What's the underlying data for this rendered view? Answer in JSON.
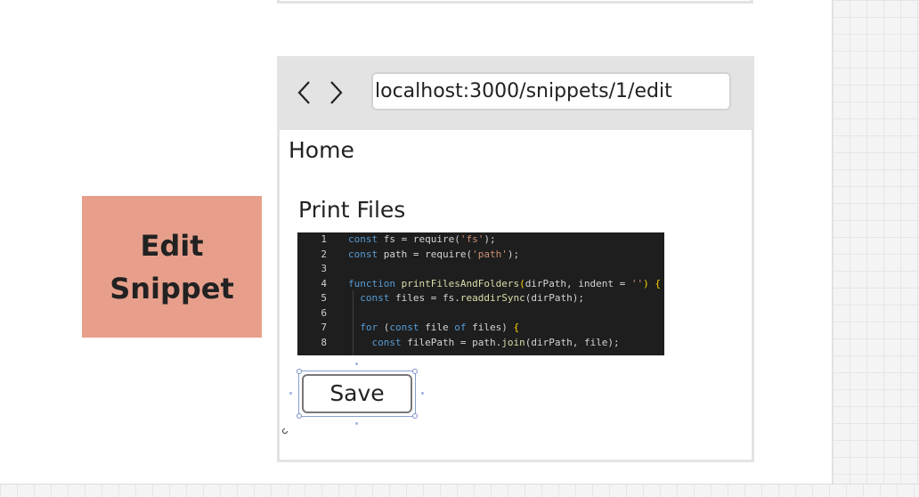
{
  "label_card": {
    "text": "Edit\nSnippet",
    "color": "#e79f8b"
  },
  "browser": {
    "back_icon": "chevron-left-icon",
    "forward_icon": "chevron-right-icon",
    "url": "localhost:3000/snippets/1/edit",
    "home_link": "Home",
    "snippet_title": "Print Files",
    "save_label": "Save"
  },
  "code_editor": {
    "line_numbers": [
      "1",
      "2",
      "3",
      "4",
      "5",
      "6",
      "7",
      "8"
    ]
  }
}
